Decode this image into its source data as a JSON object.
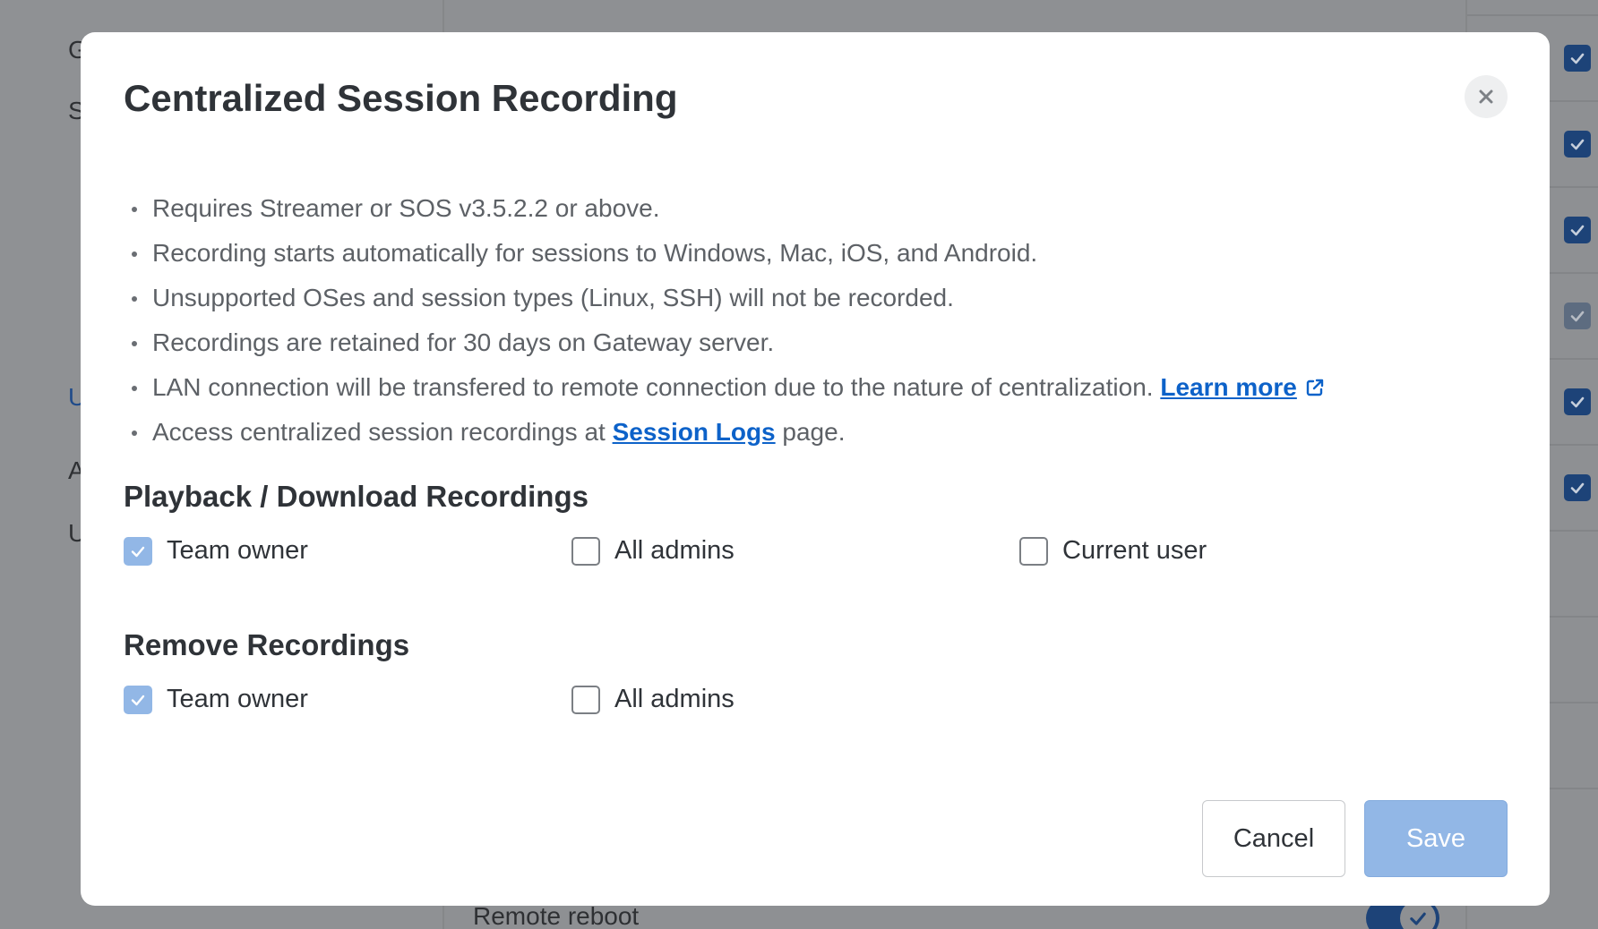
{
  "background": {
    "sidebar_letters": [
      "G",
      "S",
      "U",
      "A",
      "U"
    ],
    "bottom_row_label": "Remote reboot"
  },
  "modal": {
    "title": "Centralized Session Recording",
    "close_icon": "close-icon",
    "bullets": [
      "Requires Streamer or SOS v3.5.2.2 or above.",
      "Recording starts automatically for sessions to Windows, Mac, iOS, and Android.",
      "Unsupported OSes and session types (Linux, SSH) will not be recorded.",
      "Recordings are retained for 30 days on Gateway server.",
      "LAN connection will be transfered to remote connection due to the nature of centralization.",
      "Access centralized session recordings at"
    ],
    "learn_more_link": "Learn more",
    "session_logs_link": "Session Logs",
    "session_logs_suffix": "page.",
    "playback": {
      "title": "Playback / Download Recordings",
      "options": [
        {
          "label": "Team owner",
          "checked": true
        },
        {
          "label": "All admins",
          "checked": false
        },
        {
          "label": "Current user",
          "checked": false
        }
      ]
    },
    "remove": {
      "title": "Remove Recordings",
      "options": [
        {
          "label": "Team owner",
          "checked": true
        },
        {
          "label": "All admins",
          "checked": false
        }
      ]
    },
    "cancel_label": "Cancel",
    "save_label": "Save"
  },
  "colors": {
    "accent": "#0d62c9",
    "checked": "#92b7e6",
    "save_disabled": "#92b7e6",
    "overlay": "#8f9194"
  }
}
